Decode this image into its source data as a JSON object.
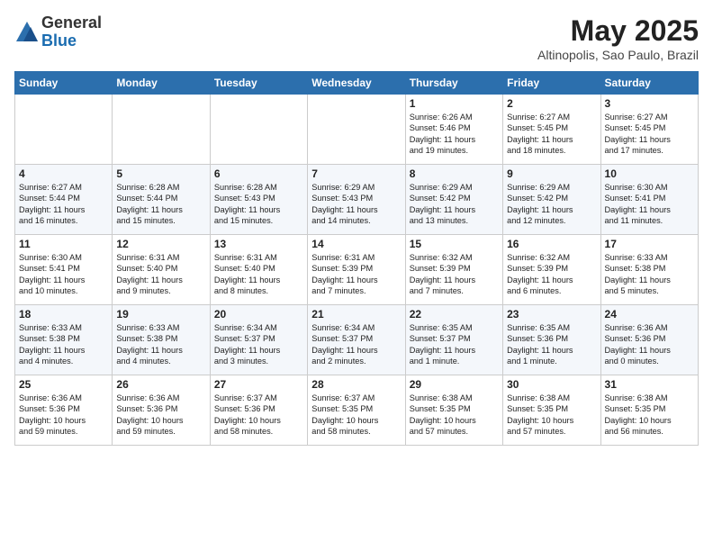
{
  "header": {
    "logo_general": "General",
    "logo_blue": "Blue",
    "month": "May 2025",
    "location": "Altinopolis, Sao Paulo, Brazil"
  },
  "days_of_week": [
    "Sunday",
    "Monday",
    "Tuesday",
    "Wednesday",
    "Thursday",
    "Friday",
    "Saturday"
  ],
  "weeks": [
    [
      {
        "day": "",
        "info": ""
      },
      {
        "day": "",
        "info": ""
      },
      {
        "day": "",
        "info": ""
      },
      {
        "day": "",
        "info": ""
      },
      {
        "day": "1",
        "info": "Sunrise: 6:26 AM\nSunset: 5:46 PM\nDaylight: 11 hours\nand 19 minutes."
      },
      {
        "day": "2",
        "info": "Sunrise: 6:27 AM\nSunset: 5:45 PM\nDaylight: 11 hours\nand 18 minutes."
      },
      {
        "day": "3",
        "info": "Sunrise: 6:27 AM\nSunset: 5:45 PM\nDaylight: 11 hours\nand 17 minutes."
      }
    ],
    [
      {
        "day": "4",
        "info": "Sunrise: 6:27 AM\nSunset: 5:44 PM\nDaylight: 11 hours\nand 16 minutes."
      },
      {
        "day": "5",
        "info": "Sunrise: 6:28 AM\nSunset: 5:44 PM\nDaylight: 11 hours\nand 15 minutes."
      },
      {
        "day": "6",
        "info": "Sunrise: 6:28 AM\nSunset: 5:43 PM\nDaylight: 11 hours\nand 15 minutes."
      },
      {
        "day": "7",
        "info": "Sunrise: 6:29 AM\nSunset: 5:43 PM\nDaylight: 11 hours\nand 14 minutes."
      },
      {
        "day": "8",
        "info": "Sunrise: 6:29 AM\nSunset: 5:42 PM\nDaylight: 11 hours\nand 13 minutes."
      },
      {
        "day": "9",
        "info": "Sunrise: 6:29 AM\nSunset: 5:42 PM\nDaylight: 11 hours\nand 12 minutes."
      },
      {
        "day": "10",
        "info": "Sunrise: 6:30 AM\nSunset: 5:41 PM\nDaylight: 11 hours\nand 11 minutes."
      }
    ],
    [
      {
        "day": "11",
        "info": "Sunrise: 6:30 AM\nSunset: 5:41 PM\nDaylight: 11 hours\nand 10 minutes."
      },
      {
        "day": "12",
        "info": "Sunrise: 6:31 AM\nSunset: 5:40 PM\nDaylight: 11 hours\nand 9 minutes."
      },
      {
        "day": "13",
        "info": "Sunrise: 6:31 AM\nSunset: 5:40 PM\nDaylight: 11 hours\nand 8 minutes."
      },
      {
        "day": "14",
        "info": "Sunrise: 6:31 AM\nSunset: 5:39 PM\nDaylight: 11 hours\nand 7 minutes."
      },
      {
        "day": "15",
        "info": "Sunrise: 6:32 AM\nSunset: 5:39 PM\nDaylight: 11 hours\nand 7 minutes."
      },
      {
        "day": "16",
        "info": "Sunrise: 6:32 AM\nSunset: 5:39 PM\nDaylight: 11 hours\nand 6 minutes."
      },
      {
        "day": "17",
        "info": "Sunrise: 6:33 AM\nSunset: 5:38 PM\nDaylight: 11 hours\nand 5 minutes."
      }
    ],
    [
      {
        "day": "18",
        "info": "Sunrise: 6:33 AM\nSunset: 5:38 PM\nDaylight: 11 hours\nand 4 minutes."
      },
      {
        "day": "19",
        "info": "Sunrise: 6:33 AM\nSunset: 5:38 PM\nDaylight: 11 hours\nand 4 minutes."
      },
      {
        "day": "20",
        "info": "Sunrise: 6:34 AM\nSunset: 5:37 PM\nDaylight: 11 hours\nand 3 minutes."
      },
      {
        "day": "21",
        "info": "Sunrise: 6:34 AM\nSunset: 5:37 PM\nDaylight: 11 hours\nand 2 minutes."
      },
      {
        "day": "22",
        "info": "Sunrise: 6:35 AM\nSunset: 5:37 PM\nDaylight: 11 hours\nand 1 minute."
      },
      {
        "day": "23",
        "info": "Sunrise: 6:35 AM\nSunset: 5:36 PM\nDaylight: 11 hours\nand 1 minute."
      },
      {
        "day": "24",
        "info": "Sunrise: 6:36 AM\nSunset: 5:36 PM\nDaylight: 11 hours\nand 0 minutes."
      }
    ],
    [
      {
        "day": "25",
        "info": "Sunrise: 6:36 AM\nSunset: 5:36 PM\nDaylight: 10 hours\nand 59 minutes."
      },
      {
        "day": "26",
        "info": "Sunrise: 6:36 AM\nSunset: 5:36 PM\nDaylight: 10 hours\nand 59 minutes."
      },
      {
        "day": "27",
        "info": "Sunrise: 6:37 AM\nSunset: 5:36 PM\nDaylight: 10 hours\nand 58 minutes."
      },
      {
        "day": "28",
        "info": "Sunrise: 6:37 AM\nSunset: 5:35 PM\nDaylight: 10 hours\nand 58 minutes."
      },
      {
        "day": "29",
        "info": "Sunrise: 6:38 AM\nSunset: 5:35 PM\nDaylight: 10 hours\nand 57 minutes."
      },
      {
        "day": "30",
        "info": "Sunrise: 6:38 AM\nSunset: 5:35 PM\nDaylight: 10 hours\nand 57 minutes."
      },
      {
        "day": "31",
        "info": "Sunrise: 6:38 AM\nSunset: 5:35 PM\nDaylight: 10 hours\nand 56 minutes."
      }
    ]
  ]
}
